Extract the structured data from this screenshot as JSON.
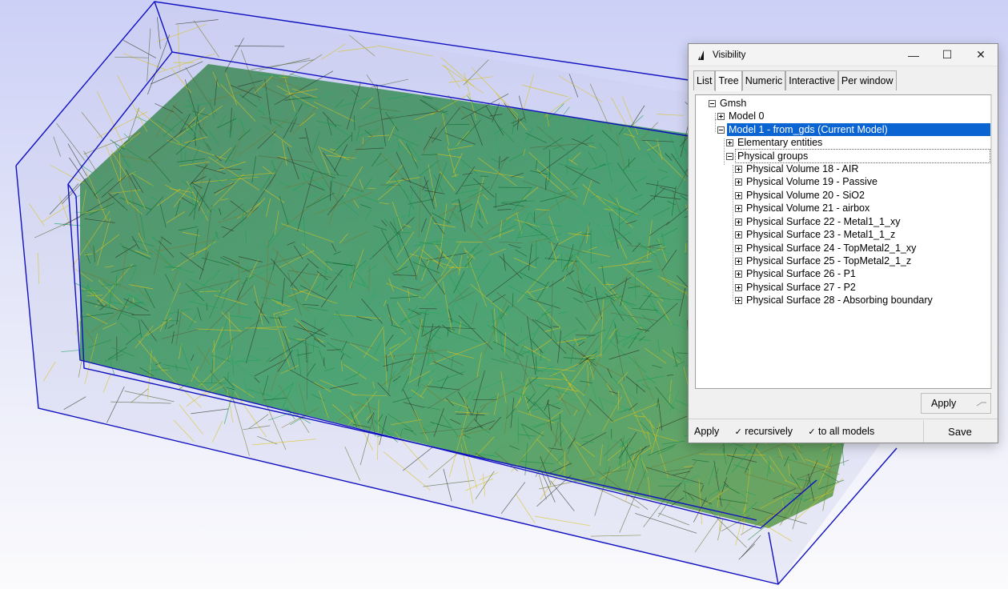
{
  "window": {
    "title": "Visibility",
    "minimize_glyph": "—",
    "maximize_glyph": "☐",
    "close_glyph": "✕"
  },
  "tabs": [
    {
      "label": "List",
      "active": false
    },
    {
      "label": "Tree",
      "active": true
    },
    {
      "label": "Numeric",
      "active": false
    },
    {
      "label": "Interactive",
      "active": false
    },
    {
      "label": "Per window",
      "active": false
    }
  ],
  "tree": {
    "root": "Gmsh",
    "model0": "Model 0",
    "model1": "Model 1 - from_gds (Current Model)",
    "elementary": "Elementary entities",
    "physical": "Physical groups",
    "groups": [
      "Physical Volume 18 - AIR",
      "Physical Volume 19 - Passive",
      "Physical Volume 20 - SiO2",
      "Physical Volume 21 - airbox",
      "Physical Surface 22 - Metal1_1_xy",
      "Physical Surface 23 - Metal1_1_z",
      "Physical Surface 24 - TopMetal2_1_xy",
      "Physical Surface 25 - TopMetal2_1_z",
      "Physical Surface 26 - P1",
      "Physical Surface 27 - P2",
      "Physical Surface 28 - Absorbing boundary"
    ]
  },
  "buttons": {
    "apply": "Apply",
    "save": "Save"
  },
  "bottom": {
    "apply_label": "Apply",
    "recursively": "recursively",
    "to_all_models": "to all models",
    "check_glyph": "✓"
  },
  "colors": {
    "selection": "#0a64d2",
    "mesh_outline": "#1010c0",
    "mesh_green": "#1d8f4a",
    "mesh_yellow": "#d9c21a",
    "mesh_dark": "#2f3a2a"
  }
}
